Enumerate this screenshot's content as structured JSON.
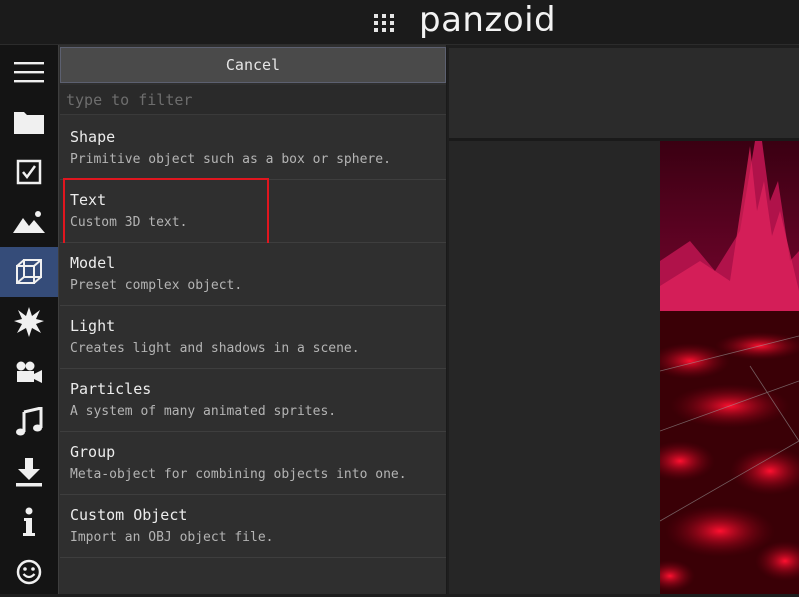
{
  "header": {
    "logo": "panzoid",
    "apps_icon": "grid-icon"
  },
  "sidebar": {
    "items": [
      {
        "icon": "menu-icon"
      },
      {
        "icon": "folder-icon"
      },
      {
        "icon": "checkbox-icon"
      },
      {
        "icon": "image-icon"
      },
      {
        "icon": "cube-icon",
        "active": true
      },
      {
        "icon": "burst-icon"
      },
      {
        "icon": "camera-icon"
      },
      {
        "icon": "music-icon"
      },
      {
        "icon": "download-icon"
      },
      {
        "icon": "info-icon"
      },
      {
        "icon": "smiley-icon"
      }
    ],
    "active_color": "#354c79"
  },
  "panel": {
    "cancel_label": "Cancel",
    "filter_placeholder": "type to filter",
    "items": [
      {
        "title": "Shape",
        "desc": "Primitive object such as a box or sphere."
      },
      {
        "title": "Text",
        "desc": "Custom 3D text."
      },
      {
        "title": "Model",
        "desc": "Preset complex object."
      },
      {
        "title": "Light",
        "desc": "Creates light and shadows in a scene."
      },
      {
        "title": "Particles",
        "desc": "A system of many animated sprites."
      },
      {
        "title": "Group",
        "desc": "Meta-object for combining objects into one."
      },
      {
        "title": "Custom Object",
        "desc": "Import an OBJ object file."
      }
    ],
    "highlight_color": "#e0161f"
  }
}
